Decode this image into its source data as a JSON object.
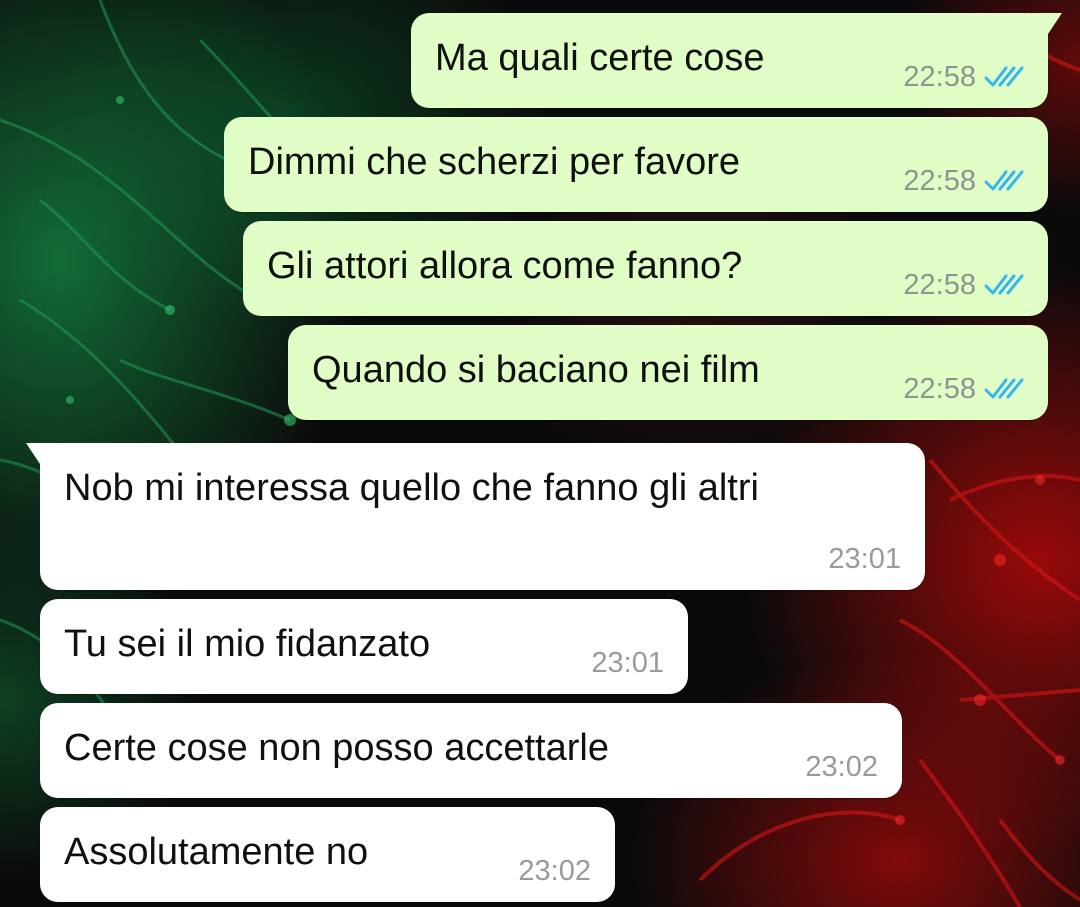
{
  "colors": {
    "outgoing_bubble": "#e1fec6",
    "incoming_bubble": "#ffffff",
    "read_ticks": "#34b7f1",
    "timestamp": "#8c9591"
  },
  "messages": [
    {
      "direction": "outgoing",
      "text": "Ma quali certe cose",
      "time": "22:58",
      "status_icon": "double-check-read-icon"
    },
    {
      "direction": "outgoing",
      "text": "Dimmi che scherzi per favore",
      "time": "22:58",
      "status_icon": "double-check-read-icon"
    },
    {
      "direction": "outgoing",
      "text": "Gli attori allora come fanno?",
      "time": "22:58",
      "status_icon": "double-check-read-icon"
    },
    {
      "direction": "outgoing",
      "text": "Quando si baciano nei film",
      "time": "22:58",
      "status_icon": "double-check-read-icon"
    },
    {
      "direction": "incoming",
      "text": "Nob mi interessa quello che fanno gli altri",
      "time": "23:01"
    },
    {
      "direction": "incoming",
      "text": "Tu sei il mio fidanzato",
      "time": "23:01"
    },
    {
      "direction": "incoming",
      "text": "Certe cose non posso accettarle",
      "time": "23:02"
    },
    {
      "direction": "incoming",
      "text": "Assolutamente no",
      "time": "23:02"
    }
  ]
}
